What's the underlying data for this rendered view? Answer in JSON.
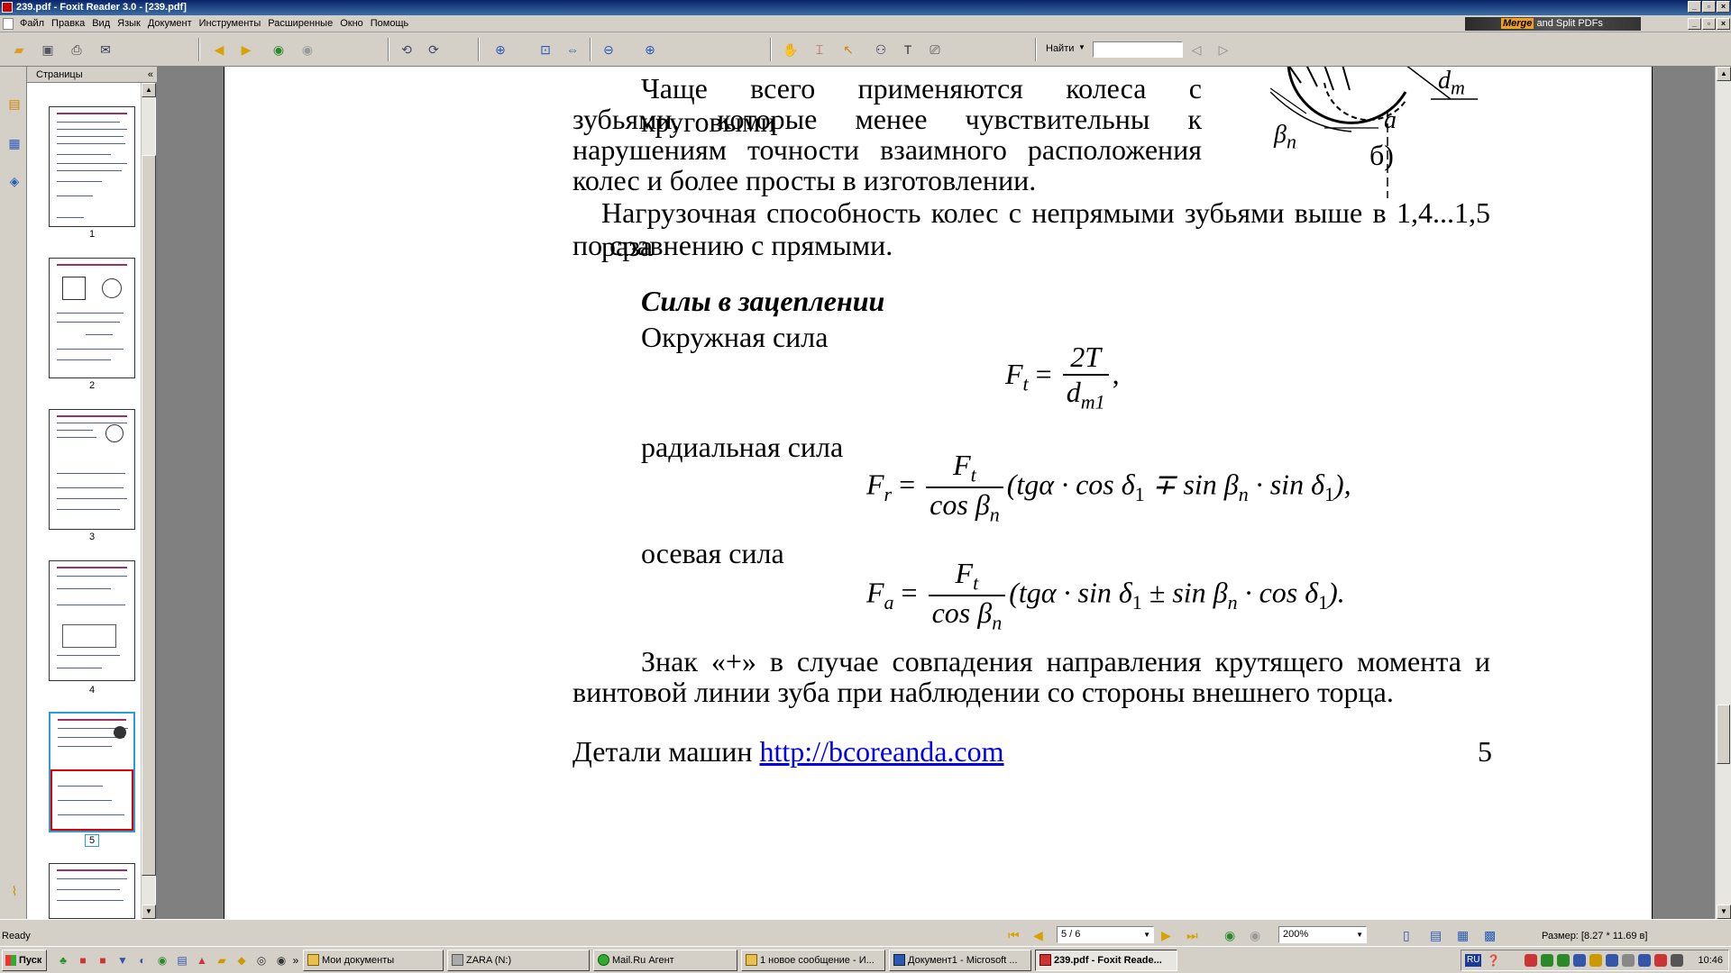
{
  "window": {
    "title": "239.pdf - Foxit Reader 3.0 - [239.pdf]"
  },
  "menubar": {
    "items": [
      "Файл",
      "Правка",
      "Вид",
      "Язык",
      "Документ",
      "Инструменты",
      "Расширенные",
      "Окно",
      "Помощь"
    ],
    "banner": {
      "brand": "Merge",
      "rest": "and Split PDFs"
    }
  },
  "toolbar": {
    "find_label": "Найти",
    "find_value": ""
  },
  "pages_panel": {
    "title": "Страницы",
    "collapse": "«",
    "thumbnails": [
      {
        "num": "1"
      },
      {
        "num": "2"
      },
      {
        "num": "3"
      },
      {
        "num": "4"
      },
      {
        "num": "5"
      },
      {
        "num": ""
      }
    ],
    "selected": "5"
  },
  "document": {
    "figure": {
      "dm": "d",
      "dm_sub": "m",
      "a": "a",
      "beta": "β",
      "beta_sub": "n",
      "label": "б)"
    },
    "para1_lines": [
      "Чаще всего применяются колеса с круговыми",
      "зубьями, которые менее чувствительны к",
      "нарушениям точности взаимного расположения",
      "колес и более просты в изготовлении."
    ],
    "para2_lines": [
      "Нагрузочная способность колес с непрямыми зубьями выше в 1,4...1,5 раза",
      "по сравнению с прямыми."
    ],
    "heading": "Силы в зацеплении",
    "label_circ": "Окружная сила",
    "label_rad": "радиальная сила",
    "label_ax": "осевая сила",
    "formula_ft": {
      "lhs": "F",
      "lhs_sub": "t",
      "num": "2T",
      "den": "d",
      "den_sub": "m1",
      "tail": ","
    },
    "formula_fr": {
      "lhs": "F",
      "lhs_sub": "r",
      "num": "F",
      "num_sub": "t",
      "den": "cos β",
      "den_sub": "n",
      "body": "(tgα · cos δ",
      "s1": "1",
      "op": " ∓ sin β",
      "s2": "n",
      "mid": " · sin δ",
      "s3": "1",
      "tail": "),"
    },
    "formula_fa": {
      "lhs": "F",
      "lhs_sub": "a",
      "num": "F",
      "num_sub": "t",
      "den": "cos β",
      "den_sub": "n",
      "body": "(tgα · sin δ",
      "s1": "1",
      "op": " ± sin β",
      "s2": "n",
      "mid": " · cos δ",
      "s3": "1",
      "tail": ")."
    },
    "para3_lines": [
      "Знак «+» в случае совпадения направления крутящего момента и",
      "винтовой линии зуба при наблюдении со стороны внешнего торца."
    ],
    "footer_text": "Детали машин ",
    "footer_link": "http://bcoreanda.com",
    "footer_page": "5"
  },
  "statusbar": {
    "ready": "Ready",
    "page_value": "5 / 6",
    "zoom_value": "200%",
    "size_label": "Размер: [8.27 * 11.69 в]"
  },
  "taskbar": {
    "start": "Пуск",
    "tasks": [
      {
        "label": "Мои документы",
        "active": false
      },
      {
        "label": "ZARA (N:)",
        "active": false
      },
      {
        "label": "Mail.Ru Агент",
        "active": false
      },
      {
        "label": "1 новое сообщение - И...",
        "active": false
      },
      {
        "label": "Документ1 - Microsoft ...",
        "active": false
      },
      {
        "label": "239.pdf - Foxit Reade...",
        "active": true
      }
    ],
    "lang": "RU",
    "clock": "10:46"
  },
  "colors": {
    "titlebar": "#0a246a",
    "link": "#0000ee",
    "selection": "#2a9fd6"
  }
}
